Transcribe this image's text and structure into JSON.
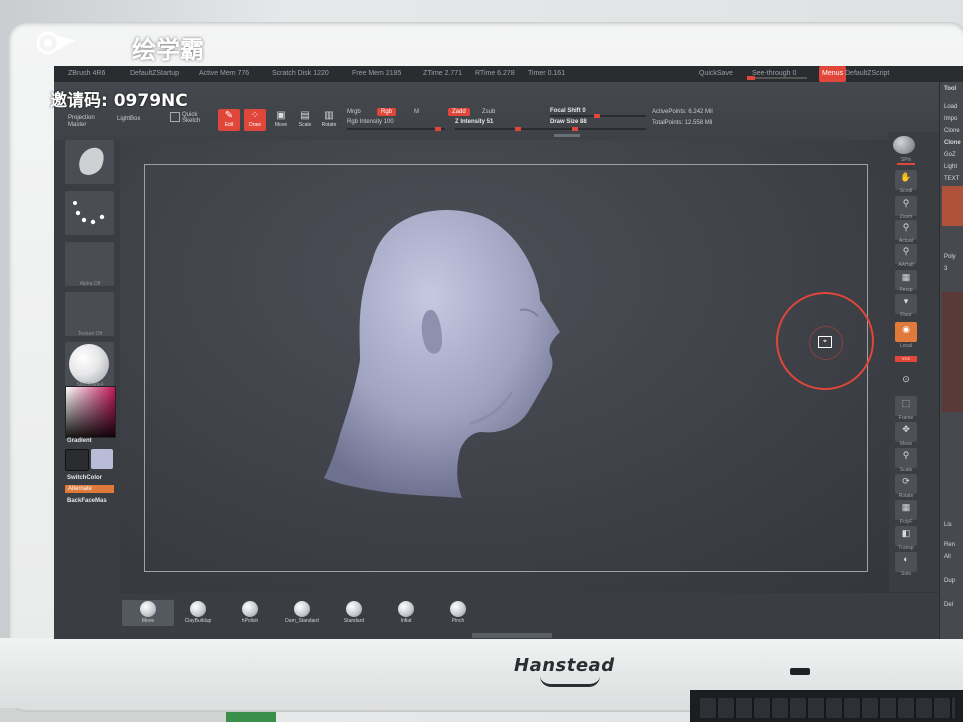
{
  "watermark": {
    "brand": "绘学霸",
    "invite_code": "邀请码: 0979NC"
  },
  "monitor": {
    "brand": "Hanstead"
  },
  "title_bar": {
    "app": "ZBrush 4R6",
    "file": "DefaultZStartup",
    "active_mem": "Active Mem 776",
    "scratch_disk": "Scratch Disk 1220",
    "free_mem": "Free Mem 2185",
    "ztime": "ZTime 2.771",
    "rtime": "RTime 6.278",
    "timer": "Timer 0.161",
    "quicksave": "QuickSave",
    "seethrough": "See-through 0",
    "menus_btn": "Menus",
    "default_script": "DefaultZScript"
  },
  "top_shelf": {
    "projection_master": "Projection Master",
    "lightbox": "LightBox",
    "quick_sketch": "Quick Sketch",
    "edit": "Edit",
    "draw": "Draw",
    "move": "Move",
    "scale": "Scale",
    "rotate": "Rotate",
    "mrgb": "Mrgb",
    "rgb": "Rgb",
    "m": "M",
    "zadd": "Zadd",
    "zsub": "Zsub",
    "rgb_intensity": "Rgb Intensity 100",
    "z_intensity": "Z Intensity 51",
    "focal_shift": "Focal Shift 0",
    "draw_size": "Draw Size 88",
    "active_points": "ActivePoints: 6.242 Mil",
    "total_points": "TotalPoints: 12.558 Mil"
  },
  "left_shelf": {
    "alpha_off": "Alpha Off",
    "texture_off": "Texture Off",
    "material": "SkinShade4",
    "gradient": "Gradient",
    "switch_color": "SwitchColor",
    "alternate": "Alternate",
    "backface": "BackFaceMas"
  },
  "right_shelf": {
    "spix": "SPix",
    "scroll": "Scroll",
    "zoom": "Zoom",
    "actual": "Actual",
    "aahalf": "AAHalf",
    "persp": "Persp",
    "floor": "Floor",
    "local": "Local",
    "xyz": "XYZ",
    "frame": "Frame",
    "move": "Move",
    "scale": "Scale",
    "rotate": "Rotate",
    "polyf": "PolyF",
    "transp": "Transp",
    "solo": "Solo",
    "xpose": "Xpose"
  },
  "tool_panel": {
    "title": "Tool",
    "items": [
      "Load",
      "Impo",
      "Clone",
      "Clone",
      "GoZ",
      "Light",
      "TEXT",
      "Poly",
      "3",
      "Lis",
      "Ren",
      "All",
      "Dup",
      "Del"
    ]
  },
  "bottom_shelf": {
    "brushes": [
      "Move",
      "ClayBuildup",
      "hPolish",
      "Dam_Standard",
      "Standard",
      "Inflat",
      "Pinch"
    ]
  },
  "colors": {
    "accent": "#e0463a",
    "accent_orange": "#e07a3a",
    "bg": "#3b3e44",
    "bust": "#a6a9c4"
  },
  "icons": {
    "edit": "pencil-icon",
    "draw": "draw-icon",
    "quick_sketch": "sketch-icon",
    "move": "move-icon",
    "scale": "scale-icon",
    "rotate": "rotate-icon",
    "brush_cursor": "brush-cursor-icon"
  }
}
